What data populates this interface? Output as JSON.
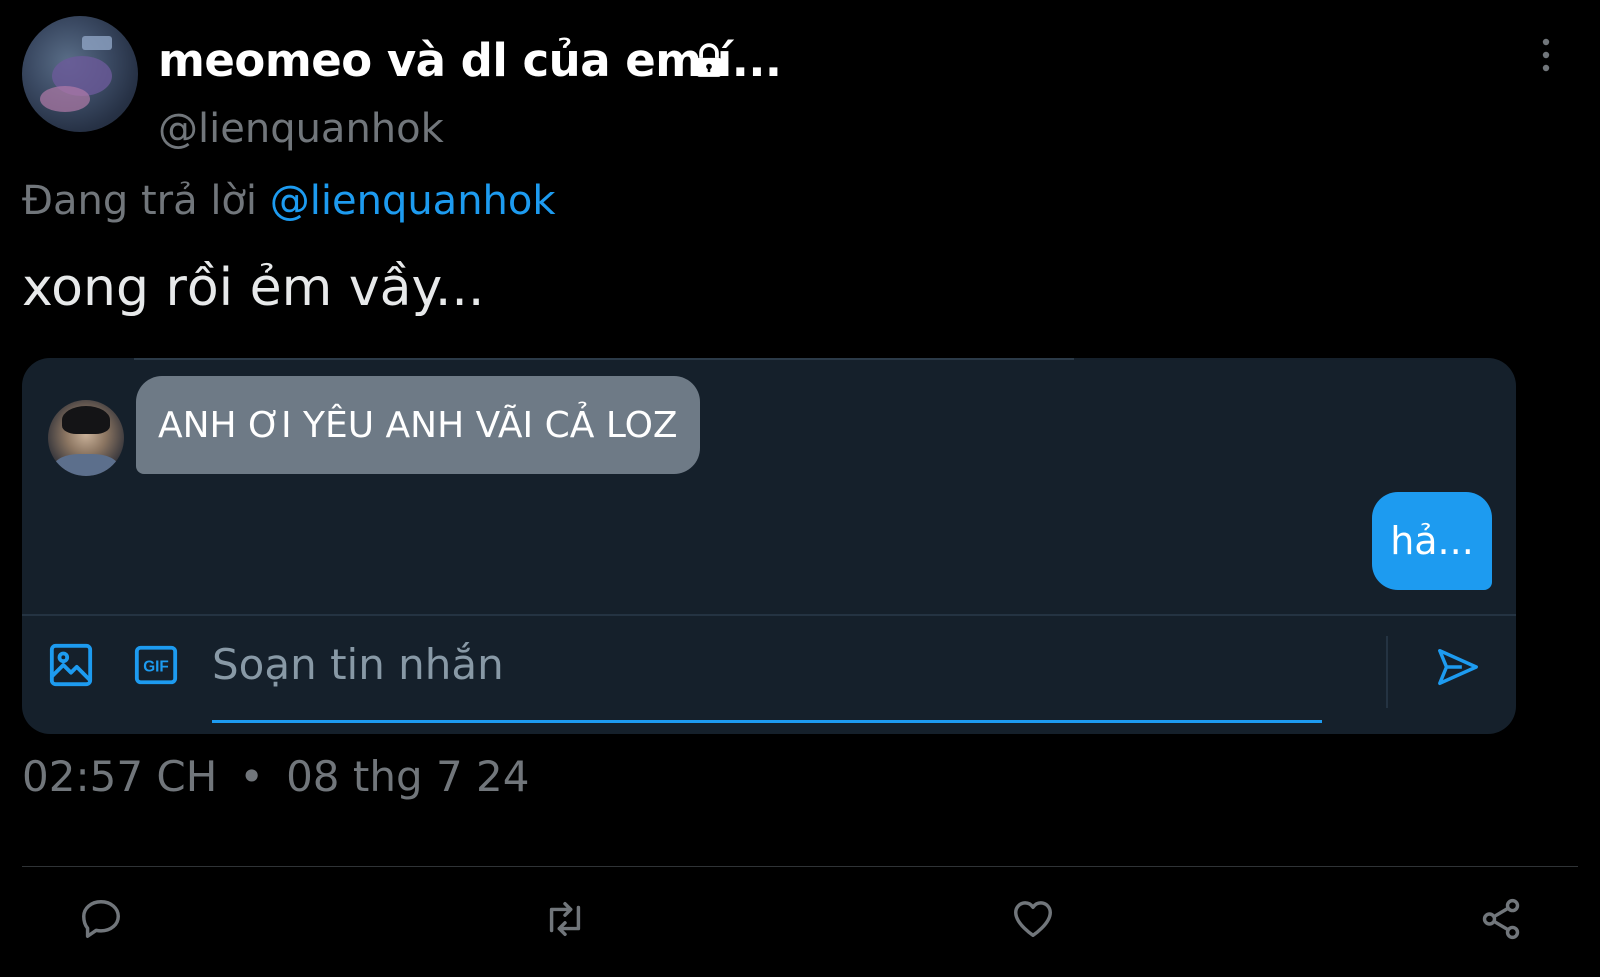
{
  "tweet": {
    "display_name": "meomeo và dl của em í...",
    "handle": "@lienquanhok",
    "replying_prefix": "Đang trả lời",
    "replying_to": "@lienquanhok",
    "text": "xong rồi ẻm vầy...",
    "time": "02:57 CH",
    "separator": "•",
    "date": "08 thg 7 24"
  },
  "dm": {
    "incoming_message": "ANH ƠI YÊU ANH VÃI CẢ LOZ",
    "outgoing_message": "hả...",
    "composer_placeholder": "Soạn tin nhắn"
  },
  "icons": {
    "lock": "lock-icon",
    "more": "more-vertical-icon",
    "image": "image-icon",
    "gif": "gif-icon",
    "gif_label": "GIF",
    "send": "send-icon",
    "reply": "reply-icon",
    "retweet": "retweet-icon",
    "like": "heart-icon",
    "share": "share-icon"
  },
  "colors": {
    "background": "#000000",
    "accent": "#1d9bf0",
    "muted_text": "#71767b",
    "dm_background": "#15202b",
    "incoming_bubble": "#6e7a86"
  }
}
